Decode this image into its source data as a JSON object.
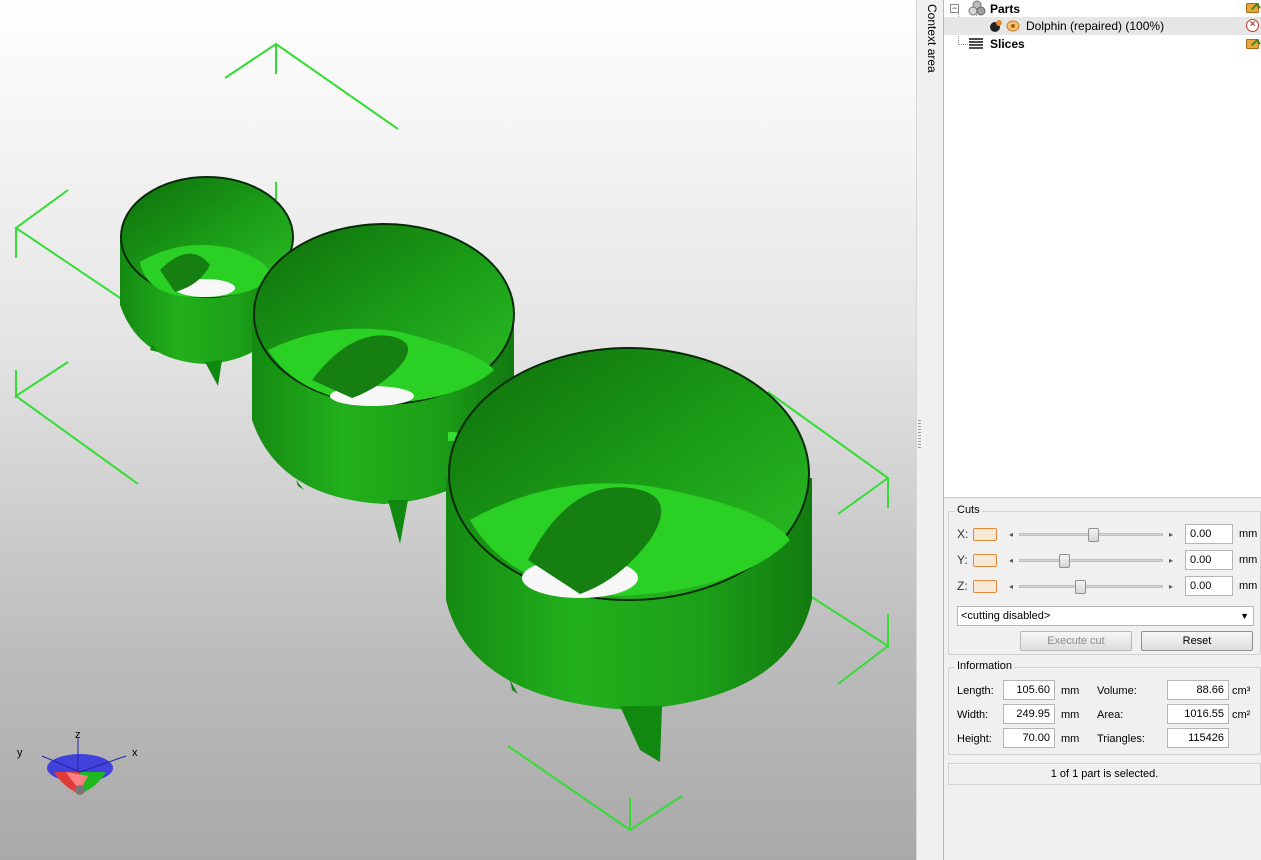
{
  "context_area": {
    "label": "Context area"
  },
  "tree": {
    "parts": {
      "label": "Parts"
    },
    "dolphin": {
      "label": "Dolphin (repaired) (100%)"
    },
    "slices": {
      "label": "Slices"
    }
  },
  "cuts": {
    "title": "Cuts",
    "axes": [
      {
        "label": "X:",
        "value": "0.00",
        "unit": "mm",
        "position": 0.52
      },
      {
        "label": "Y:",
        "value": "0.00",
        "unit": "mm",
        "position": 0.3
      },
      {
        "label": "Z:",
        "value": "0.00",
        "unit": "mm",
        "position": 0.42
      }
    ],
    "mode_selected": "<cutting disabled>",
    "execute_label": "Execute cut",
    "reset_label": "Reset"
  },
  "information": {
    "title": "Information",
    "length_label": "Length:",
    "length_value": "105.60",
    "length_unit": "mm",
    "width_label": "Width:",
    "width_value": "249.95",
    "width_unit": "mm",
    "height_label": "Height:",
    "height_value": "70.00",
    "height_unit": "mm",
    "volume_label": "Volume:",
    "volume_value": "88.66",
    "volume_unit": "cm³",
    "area_label": "Area:",
    "area_value": "1016.55",
    "area_unit": "cm²",
    "triangles_label": "Triangles:",
    "triangles_value": "115426"
  },
  "status": {
    "text": "1 of 1 part is selected."
  },
  "axes_gizmo": {
    "z": "z",
    "y": "y",
    "x": "x"
  },
  "colors": {
    "model_green": "#22a81e",
    "bbox_green": "#33dd33",
    "accent_orange": "#e08a3a"
  },
  "icons": [
    "parts-icon",
    "folder-add-icon",
    "part-icon",
    "eye-icon",
    "remove-icon",
    "slices-icon",
    "dropdown-arrow-icon"
  ]
}
